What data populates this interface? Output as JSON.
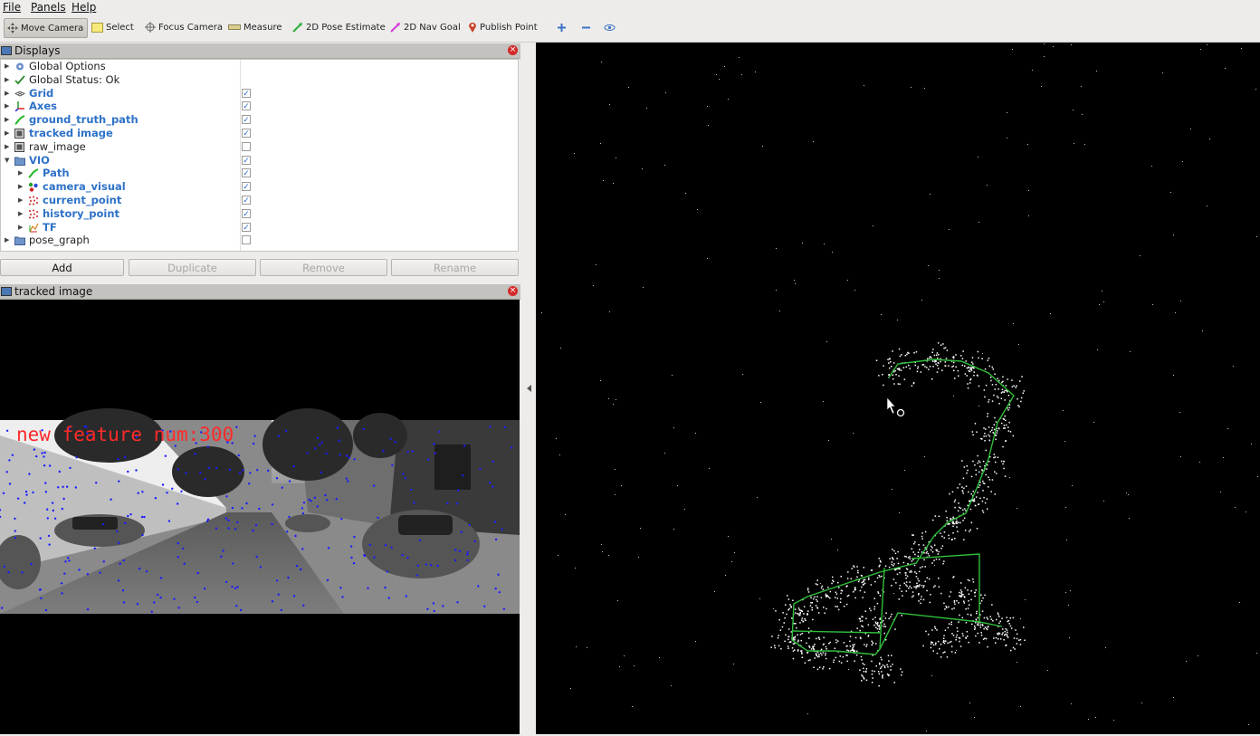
{
  "menu": {
    "file": "File",
    "panels": "Panels",
    "help": "Help"
  },
  "toolbar": {
    "move_camera": "Move Camera",
    "select": "Select",
    "focus_camera": "Focus Camera",
    "measure": "Measure",
    "pose_estimate": "2D Pose Estimate",
    "nav_goal": "2D Nav Goal",
    "publish_point": "Publish Point"
  },
  "displays": {
    "title": "Displays",
    "items": [
      {
        "label": "Global Options",
        "icon": "gear-icon",
        "checked": null,
        "indent": 0,
        "style": "normal"
      },
      {
        "label": "Global Status: Ok",
        "icon": "check-icon",
        "checked": null,
        "indent": 0,
        "style": "normal"
      },
      {
        "label": "Grid",
        "icon": "grid-icon",
        "checked": true,
        "indent": 0,
        "style": "blue"
      },
      {
        "label": "Axes",
        "icon": "axes-icon",
        "checked": true,
        "indent": 0,
        "style": "blue"
      },
      {
        "label": "ground_truth_path",
        "icon": "path-icon",
        "checked": true,
        "indent": 0,
        "style": "blue"
      },
      {
        "label": "tracked image",
        "icon": "image-icon",
        "checked": true,
        "indent": 0,
        "style": "blue"
      },
      {
        "label": "raw_image",
        "icon": "image-icon",
        "checked": false,
        "indent": 0,
        "style": "normal"
      },
      {
        "label": "VIO",
        "icon": "folder-icon",
        "checked": true,
        "indent": 0,
        "style": "blue",
        "expanded": true
      },
      {
        "label": "Path",
        "icon": "path-icon",
        "checked": true,
        "indent": 1,
        "style": "blue"
      },
      {
        "label": "camera_visual",
        "icon": "marker-icon",
        "checked": true,
        "indent": 1,
        "style": "blue"
      },
      {
        "label": "current_point",
        "icon": "pointcloud-icon",
        "checked": true,
        "indent": 1,
        "style": "blue"
      },
      {
        "label": "history_point",
        "icon": "pointcloud-icon",
        "checked": true,
        "indent": 1,
        "style": "blue"
      },
      {
        "label": "TF",
        "icon": "tf-icon",
        "checked": true,
        "indent": 1,
        "style": "blue"
      },
      {
        "label": "pose_graph",
        "icon": "folder-icon",
        "checked": false,
        "indent": 0,
        "style": "normal"
      }
    ]
  },
  "buttons": {
    "add": "Add",
    "duplicate": "Duplicate",
    "remove": "Remove",
    "rename": "Rename"
  },
  "image_panel": {
    "title": "tracked image",
    "overlay_text": "new feature num:300"
  },
  "colors": {
    "accent_blue": "#2e72c8",
    "path_green": "#2fae3a",
    "close_red": "#d42a2a"
  }
}
